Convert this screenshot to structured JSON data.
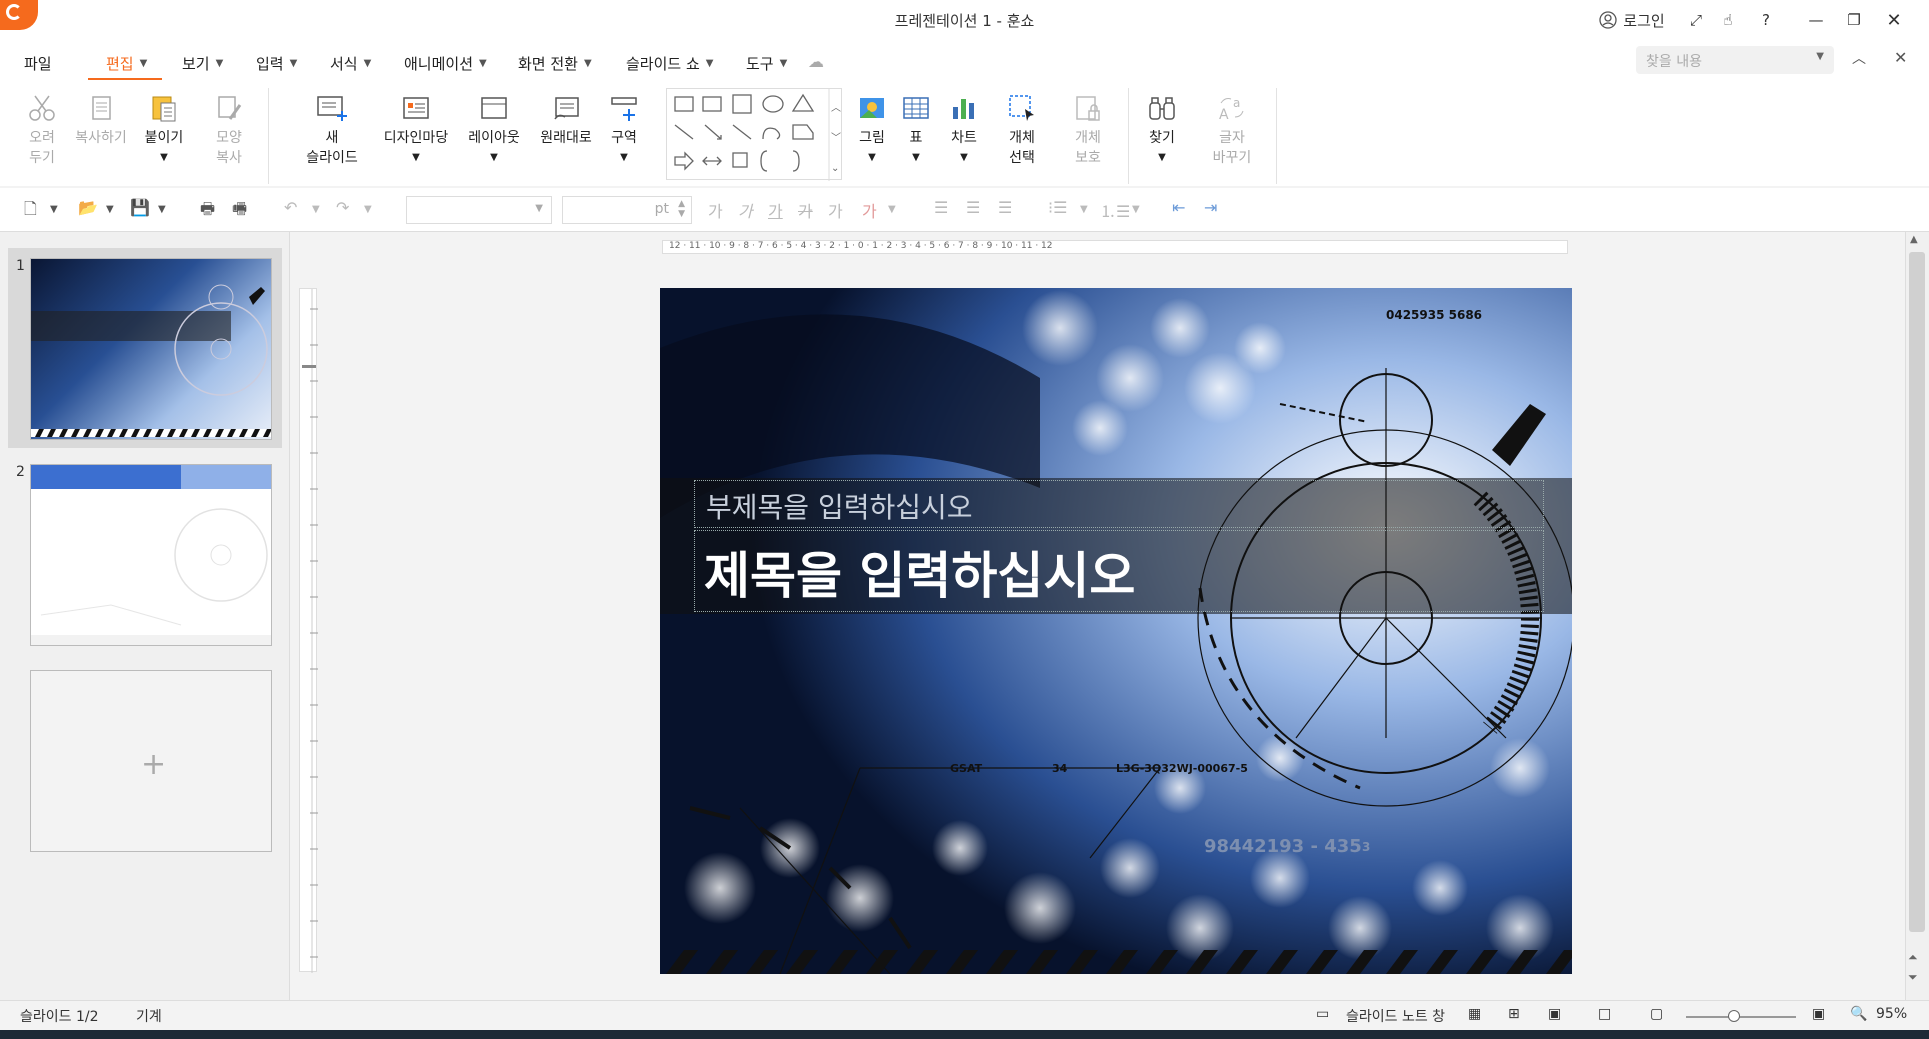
{
  "window": {
    "title": "프레젠테이션 1 - 훈쇼",
    "login_label": "로그인"
  },
  "menu": {
    "items": [
      "파일",
      "편집",
      "보기",
      "입력",
      "서식",
      "애니메이션",
      "화면 전환",
      "슬라이드 쇼",
      "도구"
    ],
    "active": "편집",
    "search_placeholder": "찾을 내용"
  },
  "ribbon": {
    "cut": [
      "오려",
      "두기"
    ],
    "copy": "복사하기",
    "paste": "붙이기",
    "format_copy": [
      "모양",
      "복사"
    ],
    "new_slide": [
      "새",
      "슬라이드"
    ],
    "design": "디자인마당",
    "layout": "레이아웃",
    "reset": "원래대로",
    "section": "구역",
    "picture": "그림",
    "table": "표",
    "chart": "차트",
    "object_select": [
      "개체",
      "선택"
    ],
    "object_protect": [
      "개체",
      "보호"
    ],
    "find": "찾기",
    "replace": [
      "글자",
      "바꾸기"
    ]
  },
  "toolbar2": {
    "font_unit": "pt",
    "char_glyph": "가"
  },
  "slides": {
    "numbers": [
      "1",
      "2"
    ]
  },
  "slide": {
    "subtitle": "부제목을 입력하십시오",
    "title": "제목을 입력하십시오",
    "deco_number": "0425935 5686",
    "deco_code1": "GSAT",
    "deco_code2": "34",
    "deco_code3": "L3G-3Q32WJ-00067-5",
    "deco_code4": "98442193 - 435",
    "deco_code5": "3"
  },
  "ruler": {
    "h_labels": "12 · 11 · 10 · 9 · 8 · 7 · 6 · 5 · 4 · 3 · 2 · 1 · 0 · 1 · 2 · 3 · 4 · 5 · 6 · 7 · 8 · 9 · 10 · 11 · 12"
  },
  "status": {
    "slide_count": "슬라이드 1/2",
    "theme": "기계",
    "notes": "슬라이드 노트 창",
    "zoom": "95%"
  },
  "colors": {
    "accent": "#f56a1d",
    "slide_bg": "#0c1a3a"
  }
}
